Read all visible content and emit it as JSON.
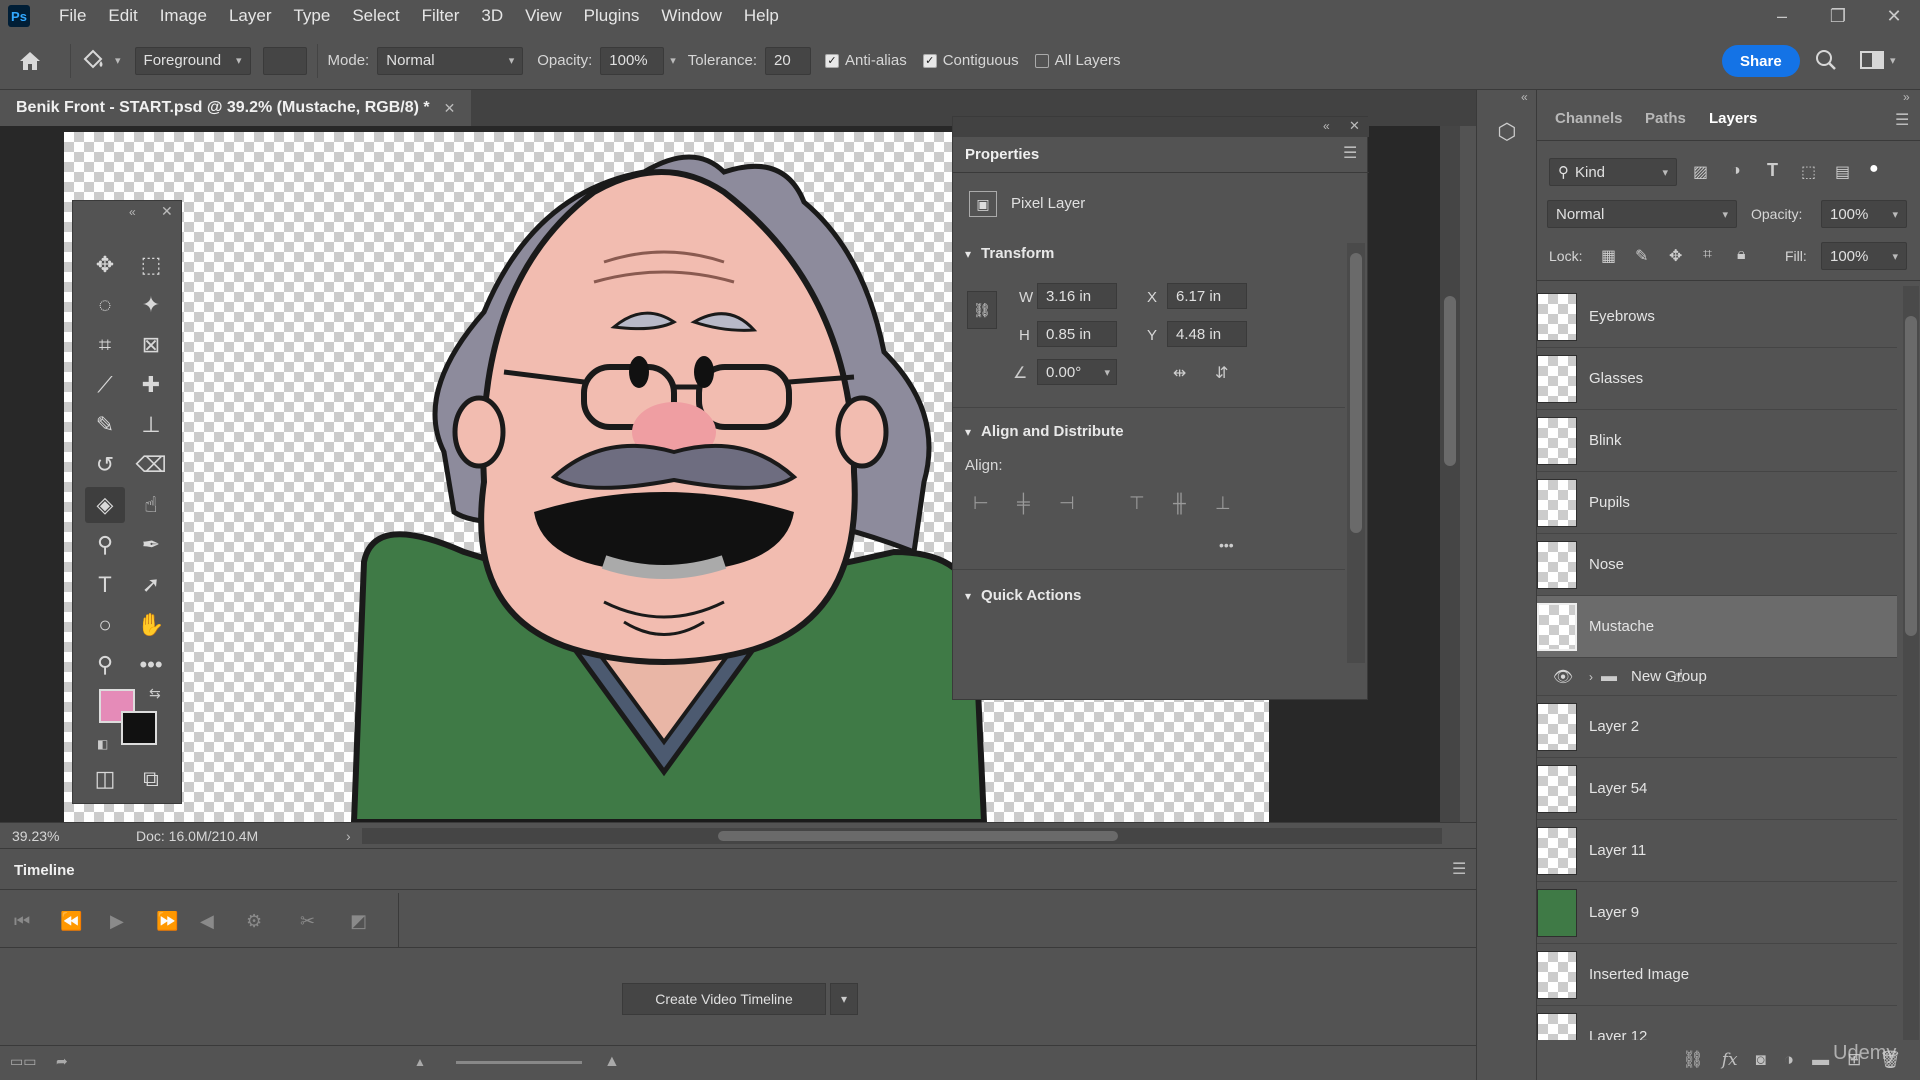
{
  "app": {
    "logo": "Ps"
  },
  "menu": [
    "File",
    "Edit",
    "Image",
    "Layer",
    "Type",
    "Select",
    "Filter",
    "3D",
    "View",
    "Plugins",
    "Window",
    "Help"
  ],
  "window_controls": {
    "minimize": "–",
    "restore": "❐",
    "close": "✕"
  },
  "options": {
    "fill_source": "Foreground",
    "mode_label": "Mode:",
    "mode_value": "Normal",
    "opacity_label": "Opacity:",
    "opacity_value": "100%",
    "tolerance_label": "Tolerance:",
    "tolerance_value": "20",
    "antialias_label": "Anti-alias",
    "contiguous_label": "Contiguous",
    "all_layers_label": "All Layers",
    "share_label": "Share"
  },
  "document": {
    "tab_title": "Benik Front - START.psd @ 39.2% (Mustache, RGB/8) *"
  },
  "status": {
    "zoom": "39.23%",
    "doc": "Doc: 16.0M/210.4M"
  },
  "properties": {
    "title": "Properties",
    "layer_type": "Pixel Layer",
    "transform_label": "Transform",
    "w_label": "W",
    "w_value": "3.16 in",
    "h_label": "H",
    "h_value": "0.85 in",
    "x_label": "X",
    "x_value": "6.17 in",
    "y_label": "Y",
    "y_value": "4.48 in",
    "angle_value": "0.00°",
    "align_section": "Align and Distribute",
    "align_label": "Align:",
    "more": "•••",
    "quick_actions": "Quick Actions"
  },
  "timeline": {
    "title": "Timeline",
    "create_button": "Create Video Timeline"
  },
  "layers_panel": {
    "tabs": [
      "Channels",
      "Paths",
      "Layers"
    ],
    "filter_kind": "Kind",
    "blend_mode": "Normal",
    "opacity_label": "Opacity:",
    "opacity_value": "100%",
    "lock_label": "Lock:",
    "fill_label": "Fill:",
    "fill_value": "100%",
    "layers": [
      {
        "name": "Eyebrows"
      },
      {
        "name": "Glasses"
      },
      {
        "name": "Blink"
      },
      {
        "name": "Pupils"
      },
      {
        "name": "Nose"
      },
      {
        "name": "Mustache",
        "selected": true
      },
      {
        "name": "New Group",
        "group": true
      },
      {
        "name": "Layer 2"
      },
      {
        "name": "Layer 54"
      },
      {
        "name": "Layer 11"
      },
      {
        "name": "Layer 9"
      },
      {
        "name": "Inserted Image"
      },
      {
        "name": "Layer 12"
      }
    ],
    "footer_icons": [
      "link-icon",
      "fx-icon",
      "mask-icon",
      "adjustment-icon",
      "folder-icon",
      "new-layer-icon",
      "trash-icon"
    ]
  },
  "watermark": "Udemy",
  "colors": {
    "foreground": "#e58bb8",
    "background": "#111111",
    "accent": "#1473e6"
  }
}
